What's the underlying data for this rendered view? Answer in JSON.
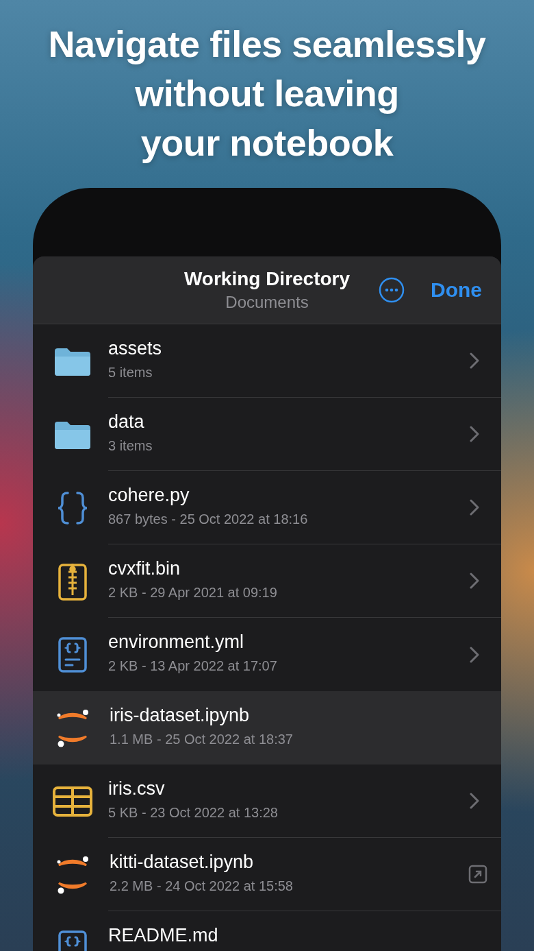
{
  "headline": [
    "Navigate files seamlessly",
    "without leaving",
    "your notebook"
  ],
  "sheet": {
    "title": "Working Directory",
    "subtitle": "Documents",
    "done": "Done"
  },
  "files": [
    {
      "kind": "folder",
      "name": "assets",
      "meta": "5 items",
      "accessory": {
        "kind": "chevron"
      },
      "selected": false
    },
    {
      "kind": "folder",
      "name": "data",
      "meta": "3 items",
      "accessory": {
        "kind": "chevron"
      },
      "selected": false
    },
    {
      "kind": "code",
      "name": "cohere.py",
      "meta": "867 bytes - 25 Oct 2022 at 18:16",
      "accessory": {
        "kind": "chevron"
      },
      "selected": false
    },
    {
      "kind": "archive",
      "name": "cvxfit.bin",
      "meta": "2 KB - 29 Apr 2021 at 09:19",
      "accessory": {
        "kind": "chevron"
      },
      "selected": false
    },
    {
      "kind": "document",
      "name": "environment.yml",
      "meta": "2 KB - 13 Apr 2022 at 17:07",
      "accessory": {
        "kind": "chevron"
      },
      "selected": false
    },
    {
      "kind": "notebook",
      "name": "iris-dataset.ipynb",
      "meta": "1.1 MB - 25 Oct 2022 at 18:37",
      "selected": true
    },
    {
      "kind": "table",
      "name": "iris.csv",
      "meta": "5 KB - 23 Oct 2022 at 13:28",
      "accessory": {
        "kind": "chevron"
      },
      "selected": false
    },
    {
      "kind": "notebook",
      "name": "kitti-dataset.ipynb",
      "meta": "2.2 MB - 24 Oct 2022 at 15:58",
      "accessory": {
        "kind": "external"
      },
      "selected": false
    },
    {
      "kind": "document",
      "name": "README.md",
      "selected": false
    }
  ]
}
